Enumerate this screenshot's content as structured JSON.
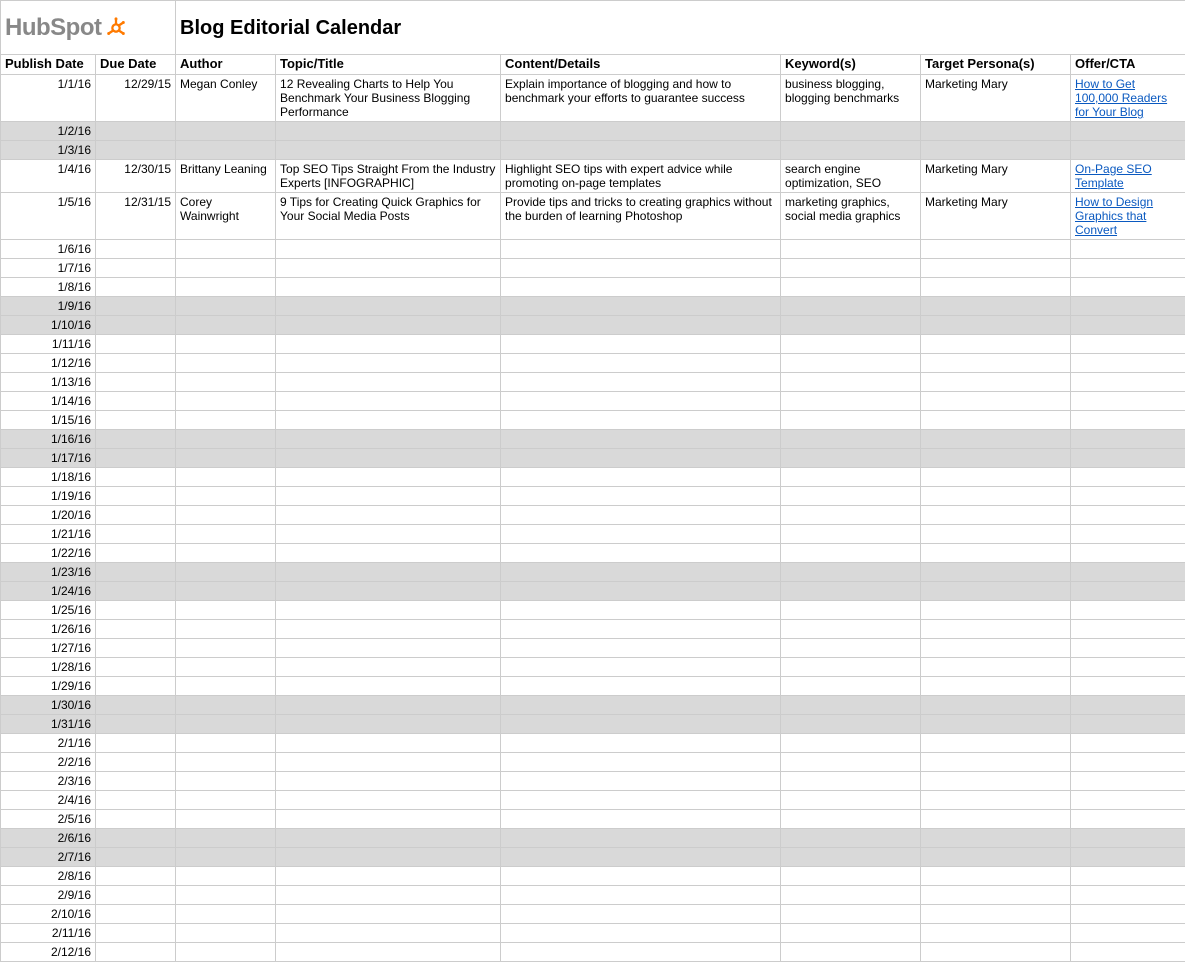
{
  "brand": "HubSpot",
  "title": "Blog Editorial Calendar",
  "columns": {
    "publish_date": "Publish Date",
    "due_date": "Due Date",
    "author": "Author",
    "topic": "Topic/Title",
    "content": "Content/Details",
    "keywords": "Keyword(s)",
    "personas": "Target Persona(s)",
    "cta": "Offer/CTA"
  },
  "rows": [
    {
      "publish": "1/1/16",
      "due": "12/29/15",
      "author": "Megan Conley",
      "topic": "12 Revealing Charts to Help You Benchmark Your Business Blogging Performance",
      "content": "Explain importance of blogging and how to benchmark your efforts to guarantee success",
      "keywords": "business blogging, blogging benchmarks",
      "personas": "Marketing Mary",
      "cta": "How to Get 100,000 Readers for Your Blog",
      "shaded": false,
      "twoline": true
    },
    {
      "publish": "1/2/16",
      "shaded": true
    },
    {
      "publish": "1/3/16",
      "shaded": true
    },
    {
      "publish": "1/4/16",
      "due": "12/30/15",
      "author": "Brittany Leaning",
      "topic": "Top SEO Tips Straight From the Industry Experts [INFOGRAPHIC]",
      "content": "Highlight SEO tips with expert advice while promoting on-page templates",
      "keywords": "search engine optimization, SEO",
      "personas": "Marketing Mary",
      "cta": "On-Page SEO Template",
      "shaded": false,
      "twoline": true
    },
    {
      "publish": "1/5/16",
      "due": "12/31/15",
      "author": "Corey Wainwright",
      "topic": "9 Tips for Creating Quick Graphics for Your Social Media Posts",
      "content": "Provide tips and tricks to creating graphics without the burden of learning Photoshop",
      "keywords": "marketing graphics, social media graphics",
      "personas": "Marketing Mary",
      "cta": "How to Design Graphics that Convert",
      "shaded": false,
      "twoline": true
    },
    {
      "publish": "1/6/16",
      "shaded": false
    },
    {
      "publish": "1/7/16",
      "shaded": false
    },
    {
      "publish": "1/8/16",
      "shaded": false
    },
    {
      "publish": "1/9/16",
      "shaded": true
    },
    {
      "publish": "1/10/16",
      "shaded": true
    },
    {
      "publish": "1/11/16",
      "shaded": false
    },
    {
      "publish": "1/12/16",
      "shaded": false
    },
    {
      "publish": "1/13/16",
      "shaded": false
    },
    {
      "publish": "1/14/16",
      "shaded": false
    },
    {
      "publish": "1/15/16",
      "shaded": false
    },
    {
      "publish": "1/16/16",
      "shaded": true
    },
    {
      "publish": "1/17/16",
      "shaded": true
    },
    {
      "publish": "1/18/16",
      "shaded": false
    },
    {
      "publish": "1/19/16",
      "shaded": false
    },
    {
      "publish": "1/20/16",
      "shaded": false
    },
    {
      "publish": "1/21/16",
      "shaded": false
    },
    {
      "publish": "1/22/16",
      "shaded": false
    },
    {
      "publish": "1/23/16",
      "shaded": true
    },
    {
      "publish": "1/24/16",
      "shaded": true
    },
    {
      "publish": "1/25/16",
      "shaded": false
    },
    {
      "publish": "1/26/16",
      "shaded": false
    },
    {
      "publish": "1/27/16",
      "shaded": false
    },
    {
      "publish": "1/28/16",
      "shaded": false
    },
    {
      "publish": "1/29/16",
      "shaded": false
    },
    {
      "publish": "1/30/16",
      "shaded": true
    },
    {
      "publish": "1/31/16",
      "shaded": true
    },
    {
      "publish": "2/1/16",
      "shaded": false
    },
    {
      "publish": "2/2/16",
      "shaded": false
    },
    {
      "publish": "2/3/16",
      "shaded": false
    },
    {
      "publish": "2/4/16",
      "shaded": false
    },
    {
      "publish": "2/5/16",
      "shaded": false
    },
    {
      "publish": "2/6/16",
      "shaded": true
    },
    {
      "publish": "2/7/16",
      "shaded": true
    },
    {
      "publish": "2/8/16",
      "shaded": false
    },
    {
      "publish": "2/9/16",
      "shaded": false
    },
    {
      "publish": "2/10/16",
      "shaded": false
    },
    {
      "publish": "2/11/16",
      "shaded": false
    },
    {
      "publish": "2/12/16",
      "shaded": false
    }
  ]
}
